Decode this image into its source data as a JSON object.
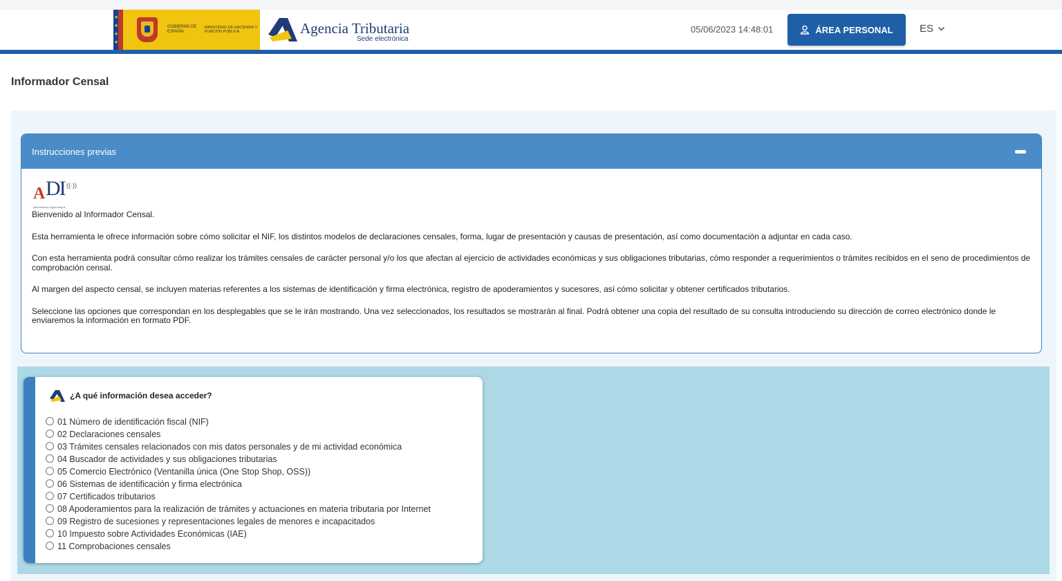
{
  "header": {
    "gov_name": "GOBIERNO DE ESPAÑA",
    "ministry_name": "MINISTERIO DE HACIENDA Y FUNCIÓN PÚBLICA",
    "agency_name": "Agencia Tributaria",
    "agency_sub": "Sede electrónica",
    "datetime": "05/06/2023 14:48:01",
    "personal_area_label": "ÁREA PERSONAL",
    "language": "ES"
  },
  "page": {
    "title": "Informador Censal"
  },
  "instructions": {
    "title": "Instrucciones previas",
    "logo_text": "Administración Digital Integral",
    "paragraphs": [
      "Bienvenido al Informador Censal.",
      "Esta herramienta le ofrece información sobre cómo solicitar el NIF, los distintos modelos de declaraciones censales, forma, lugar de presentación y causas de presentación, así como documentación a adjuntar en cada caso.",
      "Con esta herramienta podrá consultar cómo realizar los trámites censales de carácter personal y/o los que afectan al ejercicio de actividades económicas y sus obligaciones tributarias, cómo responder a requerimientos o trámites recibidos en el seno de procedimientos de comprobación censal.",
      "Al margen del aspecto censal, se incluyen materias referentes a los sistemas de identificación y firma electrónica, registro de apoderamientos y sucesores, así cómo solicitar y obtener certificados tributarios.",
      "Seleccione las opciones que correspondan en los desplegables que se le irán mostrando. Una vez seleccionados, los resultados se mostrarán al final. Podrá obtener una copia del resultado de su consulta introduciendo su dirección de correo electrónico donde le enviaremos la información en formato PDF."
    ]
  },
  "question": {
    "title": "¿A qué información desea acceder?",
    "options": [
      "01 Número de identificación fiscal (NIF)",
      "02 Declaraciones censales",
      "03 Trámites censales relacionados con mis datos personales y de mi actividad económica",
      "04 Buscador de actividades y sus obligaciones tributarias",
      "05 Comercio Electrónico (Ventanilla única (One Stop Shop, OSS))",
      "06 Sistemas de identificación y firma electrónica",
      "07 Certificados tributarios",
      "08 Apoderamientos para la realización de trámites y actuaciones en materia tributaria por Internet",
      "09 Registro de sucesiones y representaciones legales de menores e incapacitados",
      "10 Impuesto sobre Actividades Económicas (IAE)",
      "11 Comprobaciones censales"
    ]
  },
  "colors": {
    "brand_blue": "#1f5fa8",
    "panel_header": "#4a8cc8",
    "question_bg": "#add8e6"
  }
}
